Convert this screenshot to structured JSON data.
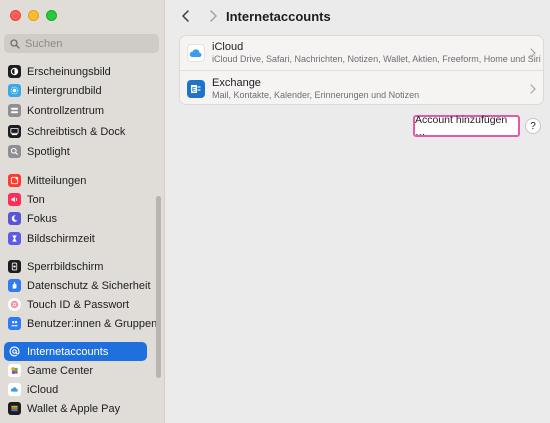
{
  "window": {
    "title": "Internetaccounts"
  },
  "sidebar": {
    "search_placeholder": "Suchen",
    "items": [
      {
        "label": "Erscheinungsbild",
        "icon": "appearance-icon",
        "color": "#1d1d1f"
      },
      {
        "label": "Hintergrundbild",
        "icon": "wallpaper-icon",
        "color": "#3aa8e8"
      },
      {
        "label": "Kontrollzentrum",
        "icon": "control-center-icon",
        "color": "#8e8e93"
      },
      {
        "label": "Schreibtisch & Dock",
        "icon": "desktop-dock-icon",
        "color": "#1d1d1f"
      },
      {
        "label": "Spotlight",
        "icon": "spotlight-icon",
        "color": "#8e8e93"
      },
      {
        "label": "Mitteilungen",
        "icon": "notifications-icon",
        "color": "#ff3b30"
      },
      {
        "label": "Ton",
        "icon": "sound-icon",
        "color": "#ff2d55"
      },
      {
        "label": "Fokus",
        "icon": "focus-icon",
        "color": "#5856d6"
      },
      {
        "label": "Bildschirmzeit",
        "icon": "screen-time-icon",
        "color": "#5e5ce6"
      },
      {
        "label": "Sperrbildschirm",
        "icon": "lock-screen-icon",
        "color": "#1d1d1f"
      },
      {
        "label": "Datenschutz & Sicherheit",
        "icon": "privacy-icon",
        "color": "#2f7bf5"
      },
      {
        "label": "Touch ID & Passwort",
        "icon": "touch-id-icon",
        "color": "#ff6482"
      },
      {
        "label": "Benutzer:innen & Gruppen",
        "icon": "users-groups-icon",
        "color": "#2f7bf5"
      },
      {
        "label": "Internetaccounts",
        "icon": "internet-accounts-icon",
        "color": "#2f7bf5",
        "selected": true
      },
      {
        "label": "Game Center",
        "icon": "game-center-icon",
        "color": "#ffffff"
      },
      {
        "label": "iCloud",
        "icon": "icloud-icon",
        "color": "#ffffff"
      },
      {
        "label": "Wallet & Apple Pay",
        "icon": "wallet-icon",
        "color": "#1d1d1f"
      }
    ]
  },
  "accounts": [
    {
      "name": "iCloud",
      "description": "iCloud Drive, Safari, Nachrichten, Notizen, Wallet, Aktien, Freeform, Home und Siri",
      "icon": "icloud-icon"
    },
    {
      "name": "Exchange",
      "description": "Mail, Kontakte, Kalender, Erinnerungen und Notizen",
      "icon": "exchange-icon"
    }
  ],
  "actions": {
    "add_account_label": "Account hinzufügen …",
    "help_label": "?"
  },
  "colors": {
    "accent": "#1f6fde",
    "highlight_border": "#e05ba8"
  }
}
